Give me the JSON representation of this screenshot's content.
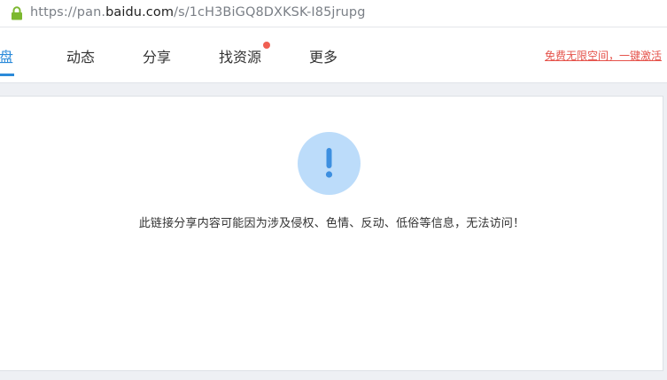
{
  "address_bar": {
    "url_prefix": "https://pan.",
    "url_domain": "baidu.com",
    "url_path": "/s/1cH3BiGQ8DXKSK-I85jrupg",
    "lock_icon": "lock-icon"
  },
  "nav": {
    "tabs": [
      {
        "label": "网盘",
        "active": true
      },
      {
        "label": "动态",
        "active": false
      },
      {
        "label": "分享",
        "active": false
      },
      {
        "label": "找资源",
        "active": false,
        "badge_dot": true
      },
      {
        "label": "更多",
        "active": false
      }
    ],
    "promo_link": "免费无限空间，一键激活",
    "accent_color": "#2b8ad9",
    "badge_color": "#f05f52"
  },
  "notice": {
    "icon": "exclamation-icon",
    "message": "此链接分享内容可能因为涉及侵权、色情、反动、低俗等信息，无法访问！"
  }
}
